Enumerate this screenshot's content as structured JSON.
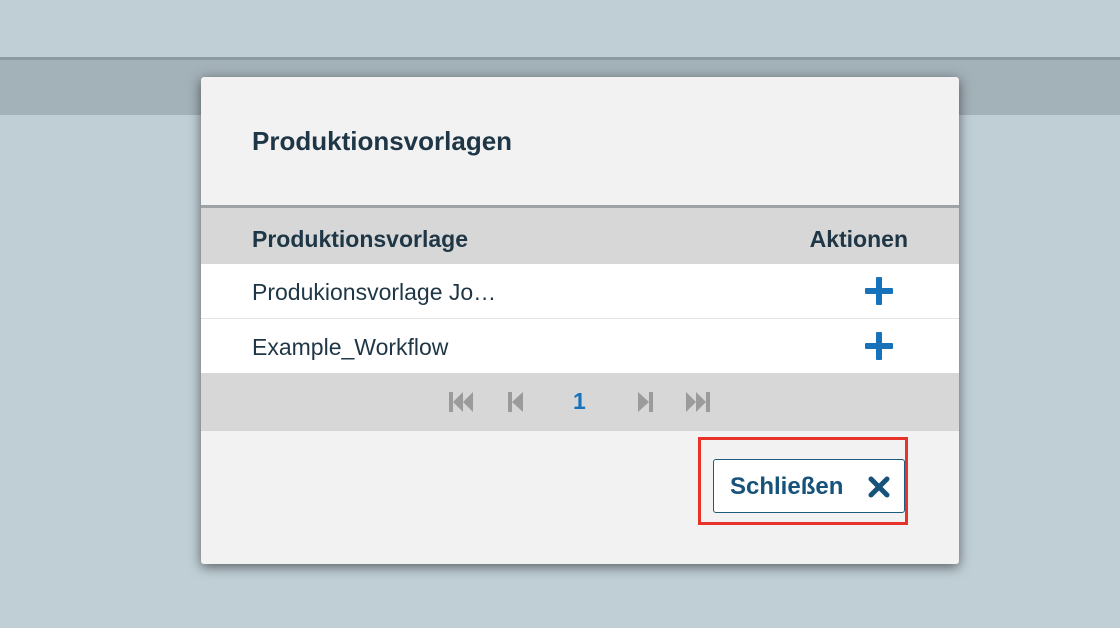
{
  "dialog": {
    "title": "Produktionsvorlagen",
    "table": {
      "columns": [
        "Produktionsvorlage",
        "Aktionen"
      ],
      "rows": [
        {
          "name": "Produkionsvorlage Jo…"
        },
        {
          "name": "Example_Workflow"
        }
      ]
    },
    "pagination": {
      "current_page": "1"
    },
    "close_button_label": "Schließen"
  },
  "colors": {
    "accent": "#1872ba",
    "title_text": "#1e3645",
    "highlight_border": "#e8332a",
    "background": "#c0cfd6"
  },
  "icons": {
    "add": "plus-icon",
    "first": "first-page-icon",
    "prev": "prev-page-icon",
    "next": "next-page-icon",
    "last": "last-page-icon",
    "close": "close-icon"
  }
}
